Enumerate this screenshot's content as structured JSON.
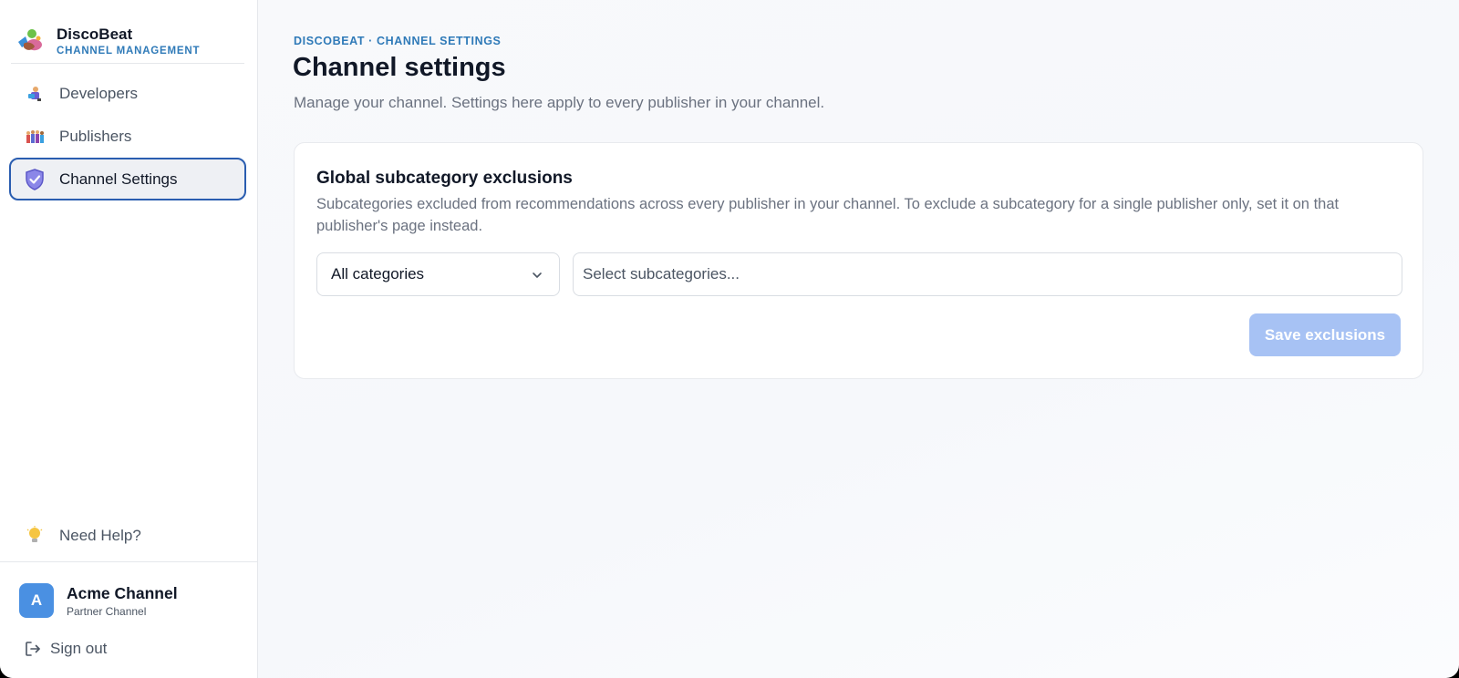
{
  "brand": {
    "name": "DiscoBeat",
    "subtitle": "CHANNEL MANAGEMENT"
  },
  "sidebar": {
    "items": [
      {
        "label": "Developers",
        "icon": "developers-icon",
        "active": false
      },
      {
        "label": "Publishers",
        "icon": "publishers-icon",
        "active": false
      },
      {
        "label": "Channel Settings",
        "icon": "shield-icon",
        "active": true
      }
    ],
    "help_label": "Need Help?",
    "account": {
      "initial": "A",
      "name": "Acme Channel",
      "role": "Partner Channel"
    },
    "signout_label": "Sign out"
  },
  "main": {
    "breadcrumb": "DISCOBEAT · CHANNEL SETTINGS",
    "title": "Channel settings",
    "subtitle": "Manage your channel. Settings here apply to every publisher in your channel.",
    "card": {
      "title": "Global subcategory exclusions",
      "description": "Subcategories excluded from recommendations across every publisher in your channel. To exclude a subcategory for a single publisher only, set it on that publisher's page instead.",
      "category_select": "All categories",
      "subcategory_placeholder": "Select subcategories...",
      "save_label": "Save exclusions",
      "save_enabled": false
    }
  },
  "colors": {
    "accent": "#2f7ab8",
    "active_border": "#2a5db0",
    "avatar": "#4a90e2",
    "save_disabled": "#a7c2f4"
  }
}
